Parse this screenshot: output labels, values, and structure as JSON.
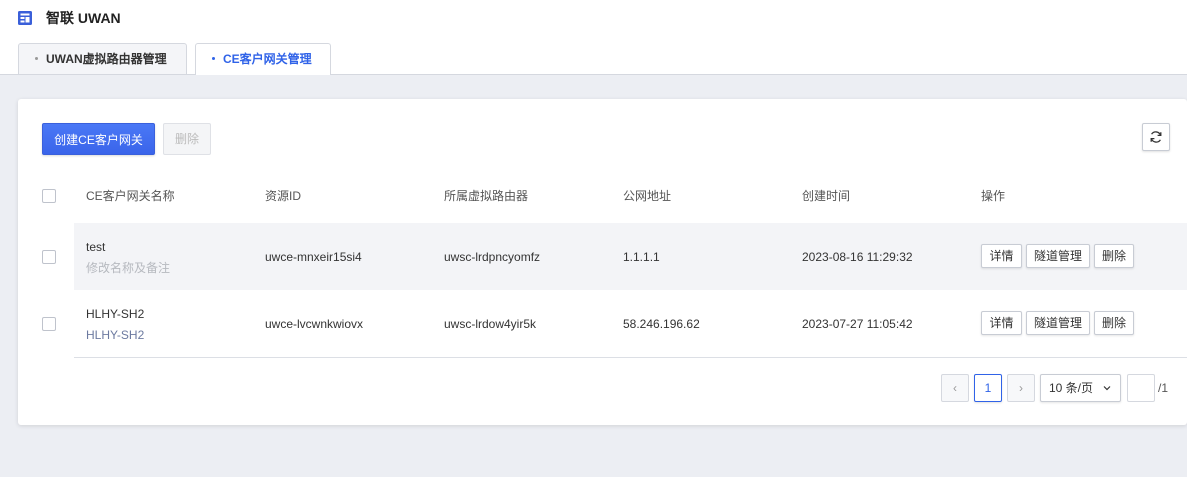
{
  "app": {
    "title": "智联 UWAN"
  },
  "tabs": [
    {
      "label": "UWAN虚拟路由器管理",
      "active": false
    },
    {
      "label": "CE客户网关管理",
      "active": true
    }
  ],
  "toolbar": {
    "create_label": "创建CE客户网关",
    "delete_label": "删除",
    "refresh_icon": "refresh-icon"
  },
  "table": {
    "columns": [
      "CE客户网关名称",
      "资源ID",
      "所属虚拟路由器",
      "公网地址",
      "创建时间",
      "操作"
    ],
    "rows": [
      {
        "name": "test",
        "sub": "修改名称及备注",
        "resource_id": "uwce-mnxeir15si4",
        "router": "uwsc-lrdpncyomfz",
        "public_ip": "1.1.1.1",
        "created": "2023-08-16 11:29:32",
        "actions": [
          "详情",
          "隧道管理",
          "删除"
        ]
      },
      {
        "name": "HLHY-SH2",
        "sub": "HLHY-SH2",
        "resource_id": "uwce-lvcwnkwiovx",
        "router": "uwsc-lrdow4yir5k",
        "public_ip": "58.246.196.62",
        "created": "2023-07-27 11:05:42",
        "actions": [
          "详情",
          "隧道管理",
          "删除"
        ]
      }
    ]
  },
  "pagination": {
    "prev": "‹",
    "next": "›",
    "current_page": "1",
    "page_size": "10 条/页",
    "jump_value": "",
    "total_pages": "/1"
  },
  "colors": {
    "accent": "#3063e8",
    "page_bg": "#eceef3",
    "row_highlight": "#f3f4f7"
  }
}
